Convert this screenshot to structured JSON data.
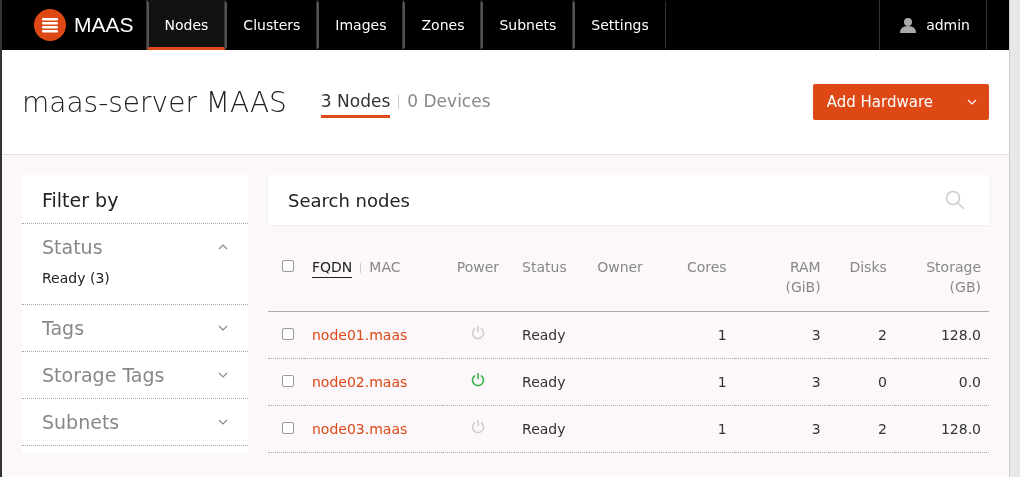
{
  "brand": {
    "name": "MAAS"
  },
  "nav": [
    {
      "label": "Nodes",
      "selected": true
    },
    {
      "label": "Clusters",
      "selected": false
    },
    {
      "label": "Images",
      "selected": false
    },
    {
      "label": "Zones",
      "selected": false
    },
    {
      "label": "Subnets",
      "selected": false
    },
    {
      "label": "Settings",
      "selected": false
    }
  ],
  "user": {
    "name": "admin"
  },
  "header": {
    "title": "maas-server MAAS",
    "tabs": [
      {
        "label": "3 Nodes",
        "selected": true
      },
      {
        "label": "0 Devices",
        "selected": false
      }
    ],
    "add_button": "Add Hardware"
  },
  "filter": {
    "title": "Filter by",
    "groups": [
      {
        "label": "Status",
        "expanded": true,
        "options": [
          "Ready (3)"
        ]
      },
      {
        "label": "Tags",
        "expanded": false
      },
      {
        "label": "Storage Tags",
        "expanded": false
      },
      {
        "label": "Subnets",
        "expanded": false
      }
    ]
  },
  "search": {
    "placeholder": "Search nodes"
  },
  "table": {
    "sort_columns": [
      {
        "label": "FQDN",
        "selected": true
      },
      {
        "label": "MAC",
        "selected": false
      }
    ],
    "all_checked": false,
    "columns": [
      "Power",
      "Status",
      "Owner",
      "Cores",
      "RAM (GiB)",
      "Disks",
      "Storage (GB)"
    ],
    "rows": [
      {
        "fqdn": "node01.maas",
        "checked": false,
        "power_on": false,
        "status": "Ready",
        "cores": "1",
        "ram": "3",
        "disks": "2",
        "storage": "128.0"
      },
      {
        "fqdn": "node02.maas",
        "checked": false,
        "power_on": true,
        "status": "Ready",
        "cores": "1",
        "ram": "3",
        "disks": "0",
        "storage": "0.0"
      },
      {
        "fqdn": "node03.maas",
        "checked": false,
        "power_on": false,
        "status": "Ready",
        "cores": "1",
        "ram": "3",
        "disks": "2",
        "storage": "128.0"
      }
    ]
  }
}
